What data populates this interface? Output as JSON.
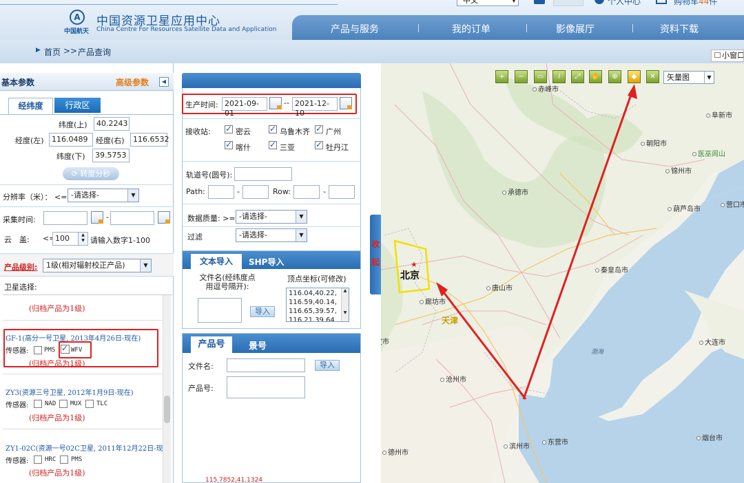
{
  "header": {
    "logo_org": "中国航天",
    "title_cn": "中国资源卫星应用中心",
    "title_en": "China Centre For Resources Satellite Data and Application",
    "language": "中文",
    "personal_center": "个人中心",
    "cart": "购物车",
    "cart_count": "44",
    "cart_unit": "件",
    "nav": [
      "产品与服务",
      "我的订单",
      "影像展厅",
      "资料下载"
    ]
  },
  "breadcrumb": {
    "home": "首页",
    "sep": ">>",
    "current": "产品查询",
    "small_window": "小窗口"
  },
  "left": {
    "basic_title": "基本参数",
    "advanced_title": "高级参数",
    "tabs": [
      "经纬度",
      "行政区"
    ],
    "lat_top_label": "纬度(上)",
    "lat_top": "40.2243",
    "lon_left_label": "经度(左)",
    "lon_left": "116.0489",
    "lon_right_label": "经度(右)",
    "lon_right": "116.6532",
    "lat_bottom_label": "纬度(下)",
    "lat_bottom": "39.5753",
    "convert_btn": "转度分秒",
    "resolution_label": "分辨率（米）：",
    "resolution_op": "<=",
    "resolution_value": "-请选择-",
    "capture_label": "采集时间:",
    "capture_dash": "-",
    "cloud_label": "云　盖:",
    "cloud_op": "<=",
    "cloud_value": "100",
    "cloud_hint": "请输入数字1-100",
    "product_level_label": "产品级别:",
    "product_level_value": "1级(相对辐射校正产品)",
    "sat_select_label": "卫星选择:",
    "archive_note": "(归档产品为1级)",
    "sensor_label": "传感器:",
    "satellites": [
      {
        "name": "GF-1(高分一号卫星, 2013年4月26日-现在)",
        "sensors": [
          {
            "name": "PMS",
            "checked": false
          },
          {
            "name": "WFV",
            "checked": true
          }
        ]
      },
      {
        "name": "ZY3(资源三号卫星, 2012年1月9日-现在)",
        "sensors": [
          {
            "name": "NAD",
            "checked": false
          },
          {
            "name": "MUX",
            "checked": false
          },
          {
            "name": "TLC",
            "checked": false
          }
        ]
      },
      {
        "name": "ZY1-02C(资源一号02C卫星, 2011年12月22日-现在)",
        "sensors": [
          {
            "name": "HRC",
            "checked": false
          },
          {
            "name": "PMS",
            "checked": false
          }
        ]
      }
    ]
  },
  "middle": {
    "prod_time_label": "生产时间:",
    "prod_time_start": "2021-09-01",
    "prod_time_sep": "--",
    "prod_time_end": "2021-12-10",
    "station_label": "接收站:",
    "stations": [
      {
        "name": "密云",
        "checked": true
      },
      {
        "name": "乌鲁木齐",
        "checked": true
      },
      {
        "name": "广州",
        "checked": true
      },
      {
        "name": "喀什",
        "checked": true
      },
      {
        "name": "三亚",
        "checked": true
      },
      {
        "name": "牡丹江",
        "checked": true
      }
    ],
    "orbit_label": "轨道号(圆号):",
    "path_label": "Path:",
    "row_label": "Row:",
    "dash": "-",
    "quality_label": "数据质量:",
    "quality_op": ">=",
    "quality_value": "-请选择-",
    "filter_label": "过滤",
    "filter_value": "-请选择-",
    "import_tabs": [
      "文本导入",
      "SHP导入"
    ],
    "file_hint": "文件名(经纬度点用逗号隔开):",
    "vertex_label": "顶点坐标(可修改)",
    "vertex_coords": [
      "116.04,40.22,",
      "116.59,40.14,",
      "116.65,39.57,",
      "116.21,39.64"
    ],
    "import_btn": "导入",
    "product_tabs": [
      "产品号",
      "景号"
    ],
    "filename_label": "文件名:",
    "product_no_label": "产品号:",
    "footer_coord": "115.7852,41.1324"
  },
  "collapse": {
    "text": "收起"
  },
  "map": {
    "layer": "矢量图",
    "tools": [
      "zoom-in",
      "zoom-out",
      "measure",
      "info",
      "full-extent",
      "pan",
      "draw-point",
      "draw-rect",
      "clear"
    ],
    "sea": "渤海",
    "cities": [
      {
        "name": "赤峰市"
      },
      {
        "name": "阜新市"
      },
      {
        "name": "朝阳市"
      },
      {
        "name": "医巫闾山"
      },
      {
        "name": "锦州市"
      },
      {
        "name": "承德市"
      },
      {
        "name": "葫芦岛市"
      },
      {
        "name": "营口市"
      },
      {
        "name": "秦皇岛市"
      },
      {
        "name": "唐山市"
      },
      {
        "name": "北京"
      },
      {
        "name": "廊坊市"
      },
      {
        "name": "天津"
      },
      {
        "name": "保定市"
      },
      {
        "name": "大连市"
      },
      {
        "name": "沧州市"
      },
      {
        "name": "东营市"
      },
      {
        "name": "滨州市"
      },
      {
        "name": "德州市"
      },
      {
        "name": "烟台市"
      }
    ]
  },
  "colors": {
    "blue": "#1c5aa0",
    "red": "#e02020",
    "nav": "#5a8ec4",
    "orange": "#e89020"
  }
}
